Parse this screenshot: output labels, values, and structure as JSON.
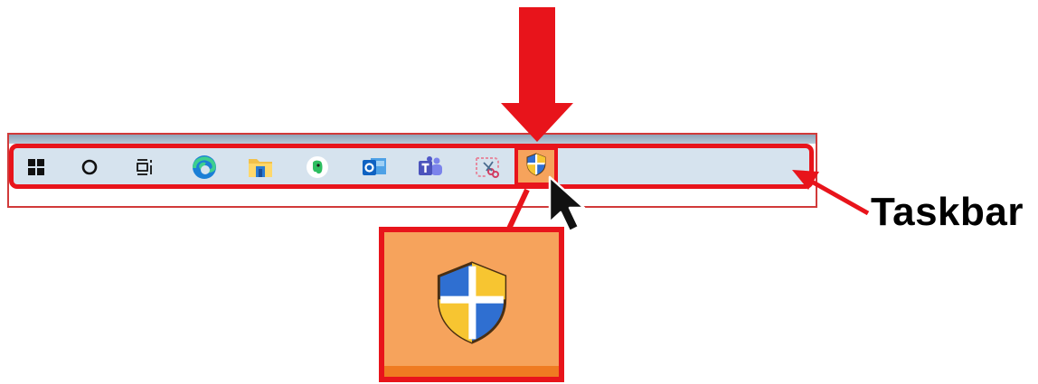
{
  "annotation": {
    "label": "Taskbar",
    "highlight_color": "#e8141b"
  },
  "taskbar": {
    "background": "#d6e3ee",
    "icons": [
      {
        "name": "windows-start-icon"
      },
      {
        "name": "cortana-search-icon"
      },
      {
        "name": "task-view-icon"
      },
      {
        "name": "edge-browser-icon"
      },
      {
        "name": "file-explorer-icon"
      },
      {
        "name": "evernote-icon"
      },
      {
        "name": "outlook-icon"
      },
      {
        "name": "teams-icon"
      },
      {
        "name": "snipping-tool-icon"
      },
      {
        "name": "security-shield-icon",
        "highlighted": true,
        "highlight_color": "#f6a35c"
      }
    ]
  },
  "zoom": {
    "icon": "security-shield-icon",
    "background": "#f6a35c"
  }
}
